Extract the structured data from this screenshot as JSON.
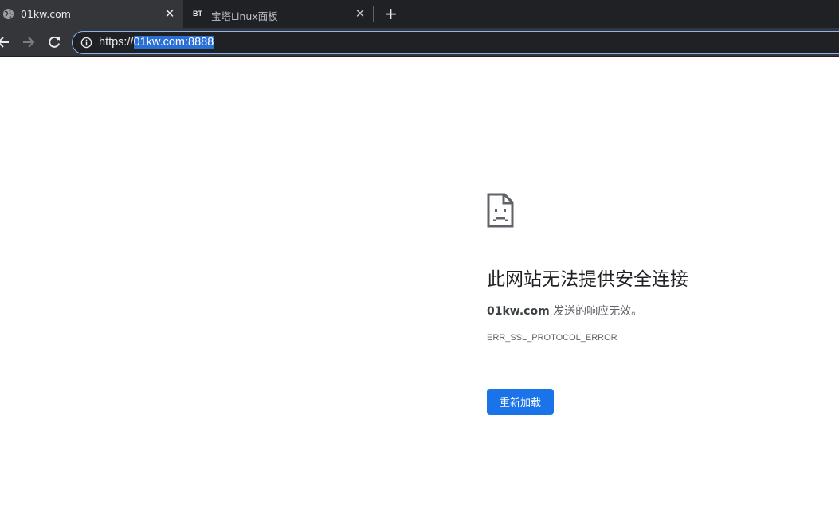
{
  "tabs": [
    {
      "title": "01kw.com",
      "favicon": "globe-icon"
    },
    {
      "title": "宝塔Linux面板",
      "favicon_text": "BT"
    }
  ],
  "toolbar": {
    "url_scheme": "https://",
    "url_host": "01kw.com:8888"
  },
  "error": {
    "heading": "此网站无法提供安全连接",
    "host": "01kw.com",
    "message_suffix": " 发送的响应无效。",
    "code": "ERR_SSL_PROTOCOL_ERROR",
    "reload_label": "重新加载"
  },
  "colors": {
    "tab_strip": "#202124",
    "active_tab": "#35363a",
    "accent": "#1a73e8",
    "omnibox_focus": "#8ab4f8"
  }
}
